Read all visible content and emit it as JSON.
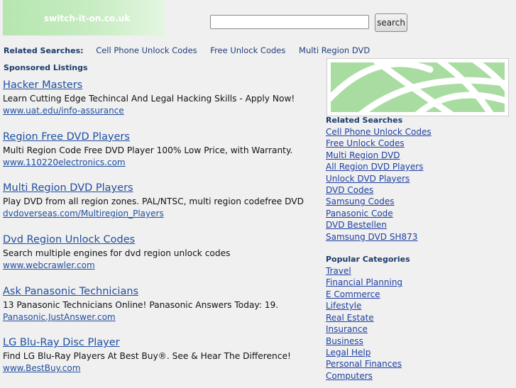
{
  "header": {
    "logo_text": "switch-it-on.co.uk",
    "search_value": "",
    "search_button": "search"
  },
  "related_bar": {
    "label": "Related Searches:",
    "links": [
      "Cell Phone Unlock Codes",
      "Free Unlock Codes",
      "Multi Region DVD"
    ]
  },
  "sponsored_label": "Sponsored Listings",
  "listings": [
    {
      "title": "Hacker Masters",
      "desc": "Learn Cutting Edge Techincal And Legal Hacking Skills - Apply Now!",
      "url": "www.uat.edu/info-assurance"
    },
    {
      "title": "Region Free DVD Players",
      "desc": "Multi Region Code Free DVD Player 100% Low Price, with Warranty.",
      "url": "www.110220electronics.com"
    },
    {
      "title": "Multi Region DVD Players",
      "desc": "Play DVD from all region zones. PAL/NTSC, multi region codefree DVD",
      "url": "dvdoverseas.com/Multiregion_Players"
    },
    {
      "title": "Dvd Region Unlock Codes",
      "desc": "Search multiple engines for dvd region unlock codes",
      "url": "www.webcrawler.com"
    },
    {
      "title": "Ask Panasonic Technicians",
      "desc": "13 Panasonic Technicians Online! Panasonic Answers Today: 19.",
      "url": "Panasonic.JustAnswer.com"
    },
    {
      "title": "LG Blu-Ray Disc Player",
      "desc": "Find LG Blu-Ray Players At Best Buy®. See & Hear The Difference!",
      "url": "www.BestBuy.com"
    }
  ],
  "sidebar": {
    "related_heading": "Related Searches",
    "related": [
      "Cell Phone Unlock Codes",
      "Free Unlock Codes",
      "Multi Region DVD",
      "All Region DVD Players",
      "Unlock DVD Players",
      "DVD Codes",
      "Samsung Codes",
      "Panasonic Code",
      "DVD Bestellen",
      "Samsung DVD SH873"
    ],
    "popular_heading": "Popular Categories",
    "popular": [
      "Travel",
      "Financial Planning",
      "E Commerce",
      "Lifestyle",
      "Real Estate",
      "Insurance",
      "Business",
      "Legal Help",
      "Personal Finances",
      "Computers"
    ]
  },
  "colors": {
    "link": "#1f4fa0",
    "heading": "#1a3b6b",
    "logo_green": "#b6e6b0",
    "banner_green": "#a9dca1"
  }
}
